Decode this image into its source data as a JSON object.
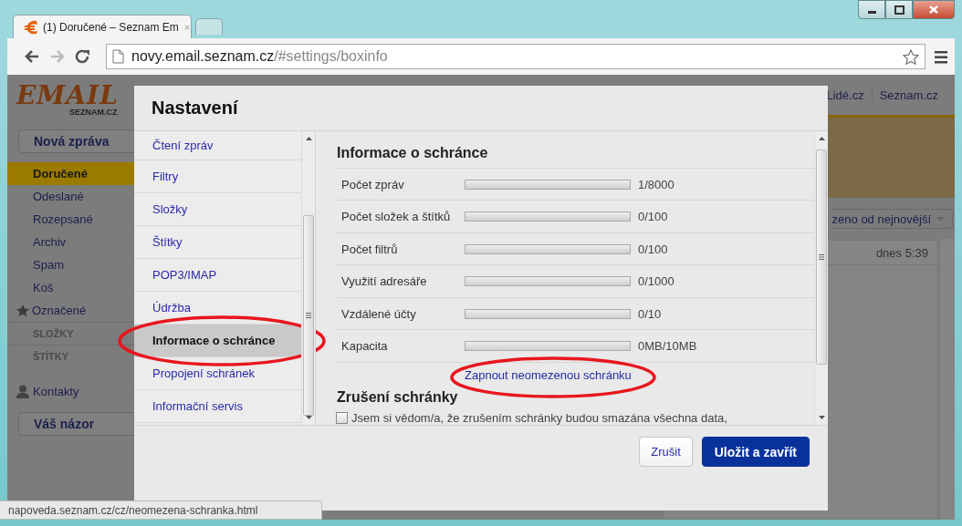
{
  "browser": {
    "tabs": [
      {
        "title": "(1) Doručené – Seznam Em",
        "close_label": "×",
        "selected": true
      },
      {
        "selected": false
      }
    ],
    "address": {
      "host": "novy.email.seznam.cz",
      "path": "/#settings/boxinfo"
    }
  },
  "app": {
    "logo": {
      "title": "EMAIL",
      "subtitle": "SEZNAM.CZ"
    },
    "header_links": [
      "Lidé.cz",
      "Seznam.cz"
    ],
    "new_message_button": "Nová zpráva",
    "folders": [
      {
        "label": "Doručené",
        "selected": true
      },
      {
        "label": "Odeslané",
        "selected": false
      },
      {
        "label": "Rozepsané",
        "selected": false
      },
      {
        "label": "Archiv",
        "selected": false
      },
      {
        "label": "Spam",
        "selected": false
      },
      {
        "label": "Koš",
        "selected": false
      },
      {
        "label": "Označené",
        "selected": false,
        "kind": "starred"
      }
    ],
    "sections": [
      "SLOŽKY",
      "ŠTÍTKY"
    ],
    "contacts": "Kontakty",
    "feedback_button": "Váš názor",
    "sort_dropdown": "zeno od nejnovější",
    "message_time": "dnes 5:39"
  },
  "dialog": {
    "title": "Nastavení",
    "nav": [
      {
        "label": "Čtení zpráv",
        "selected": false,
        "circled": false
      },
      {
        "label": "Filtry",
        "selected": false,
        "circled": false
      },
      {
        "label": "Složky",
        "selected": false,
        "circled": false
      },
      {
        "label": "Štítky",
        "selected": false,
        "circled": false
      },
      {
        "label": "POP3/IMAP",
        "selected": false,
        "circled": false
      },
      {
        "label": "Údržba",
        "selected": false,
        "circled": false
      },
      {
        "label": "Informace o schránce",
        "selected": true,
        "circled": true
      },
      {
        "label": "Propojení schránek",
        "selected": false,
        "circled": false
      },
      {
        "label": "Informační servis",
        "selected": false,
        "circled": false
      }
    ],
    "heading": "Informace o schránce",
    "stats": [
      {
        "label": "Počet zpráv",
        "level": 0.000125,
        "reading": "1/8000"
      },
      {
        "label": "Počet složek a štítků",
        "level": 0,
        "reading": "0/100"
      },
      {
        "label": "Počet filtrů",
        "level": 0,
        "reading": "0/100"
      },
      {
        "label": "Využití adresáře",
        "level": 0,
        "reading": "0/1000"
      },
      {
        "label": "Vzdálené účty",
        "level": 0,
        "reading": "0/10"
      },
      {
        "label": "Kapacita",
        "level": 0,
        "reading": "0MB/10MB"
      }
    ],
    "unlimited_link": {
      "label": "Zapnout neomezenou schránku",
      "circled": true
    },
    "cancel_heading": "Zrušení schránky",
    "cancel_checkbox": {
      "label": "Jsem si vědom/a, že zrušením schránky budou smazána všechna data,",
      "checked": false
    },
    "buttons": [
      {
        "label": "Zrušit",
        "kind": "secondary"
      },
      {
        "label": "Uložit a zavřít",
        "kind": "primary"
      }
    ]
  },
  "status_bar": "napoveda.seznam.cz/cz/neomezena-schranka.html"
}
